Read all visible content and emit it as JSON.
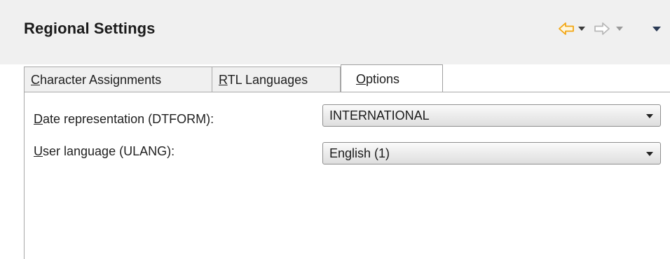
{
  "view": {
    "title": "Regional Settings",
    "nav": {
      "back_icon": "back-arrow-icon",
      "forward_icon": "forward-arrow-icon",
      "menu_icon": "view-menu-icon"
    }
  },
  "tabs": [
    {
      "mnemonic": "C",
      "rest": "haracter Assignments",
      "active": false
    },
    {
      "mnemonic": "R",
      "rest": "TL Languages",
      "active": false
    },
    {
      "mnemonic": "O",
      "rest": "ptions",
      "active": true
    }
  ],
  "options": {
    "date_label": {
      "mnemonic": "D",
      "rest": "ate representation (DTFORM):"
    },
    "date_value": "INTERNATIONAL",
    "language_label": {
      "mnemonic": "U",
      "rest": "ser language (ULANG):"
    },
    "language_value": "English (1)"
  },
  "colors": {
    "back_arrow": "#f2a614",
    "forward_arrow": "#b8b8b8",
    "dropdown_enabled": "#3a3a3a",
    "dropdown_disabled": "#9a9a9a"
  }
}
